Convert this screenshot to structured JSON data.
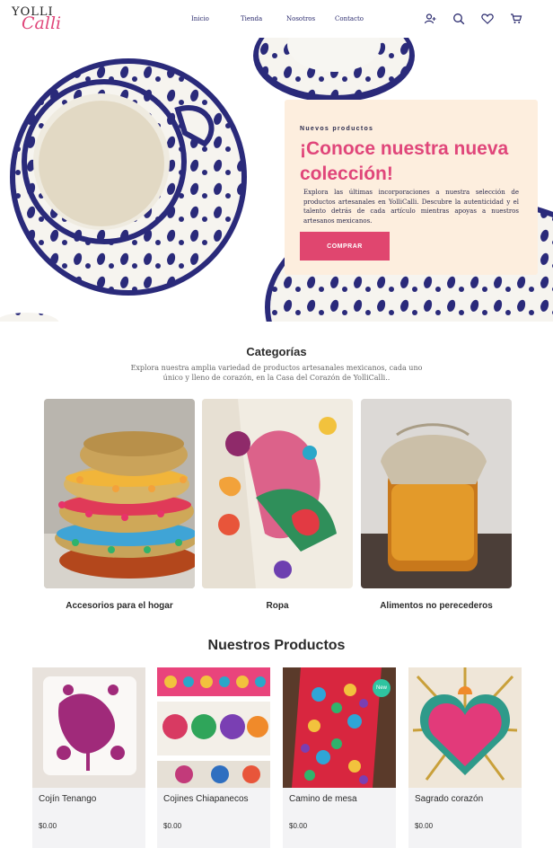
{
  "brand": {
    "logo_top": "YOLLI",
    "logo_bottom": "Calli"
  },
  "nav": {
    "items": [
      "Inicio",
      "Tienda",
      "Nosotros",
      "Contacto"
    ]
  },
  "header_icons": [
    "user-plus-icon",
    "search-icon",
    "heart-icon",
    "cart-icon"
  ],
  "hero": {
    "eyebrow": "Nuevos productos",
    "title": "¡Conoce nuestra nueva colección!",
    "text": "Explora las últimas incorporaciones a nuestra selección de productos artesanales en YolliCalli. Descubre la autenticidad y el talento detrás de cada artículo mientras apoyas a nuestros artesanos mexicanos.",
    "button": "COMPRAR"
  },
  "categories": {
    "title": "Categorías",
    "description": "Explora nuestra amplia variedad de productos artesanales mexicanos, cada uno único y lleno de corazón, en la Casa del Corazón de YolliCalli..",
    "items": [
      {
        "label": "Accesorios para el hogar"
      },
      {
        "label": "Ropa"
      },
      {
        "label": "Alimentos no perecederos"
      }
    ]
  },
  "products": {
    "title": "Nuestros Productos",
    "items": [
      {
        "name": "Cojín Tenango",
        "price": "$0.00"
      },
      {
        "name": "Cojines Chiapanecos",
        "price": "$0.00"
      },
      {
        "name": "Camino de mesa",
        "price": "$0.00",
        "badge": "New"
      },
      {
        "name": "Sagrado corazón",
        "price": "$0.00"
      }
    ]
  },
  "colors": {
    "accent_pink": "#e0467a",
    "card_beige": "#fdeede",
    "talavera_blue": "#2a2a7a",
    "badge_green": "#2ec4a0"
  }
}
